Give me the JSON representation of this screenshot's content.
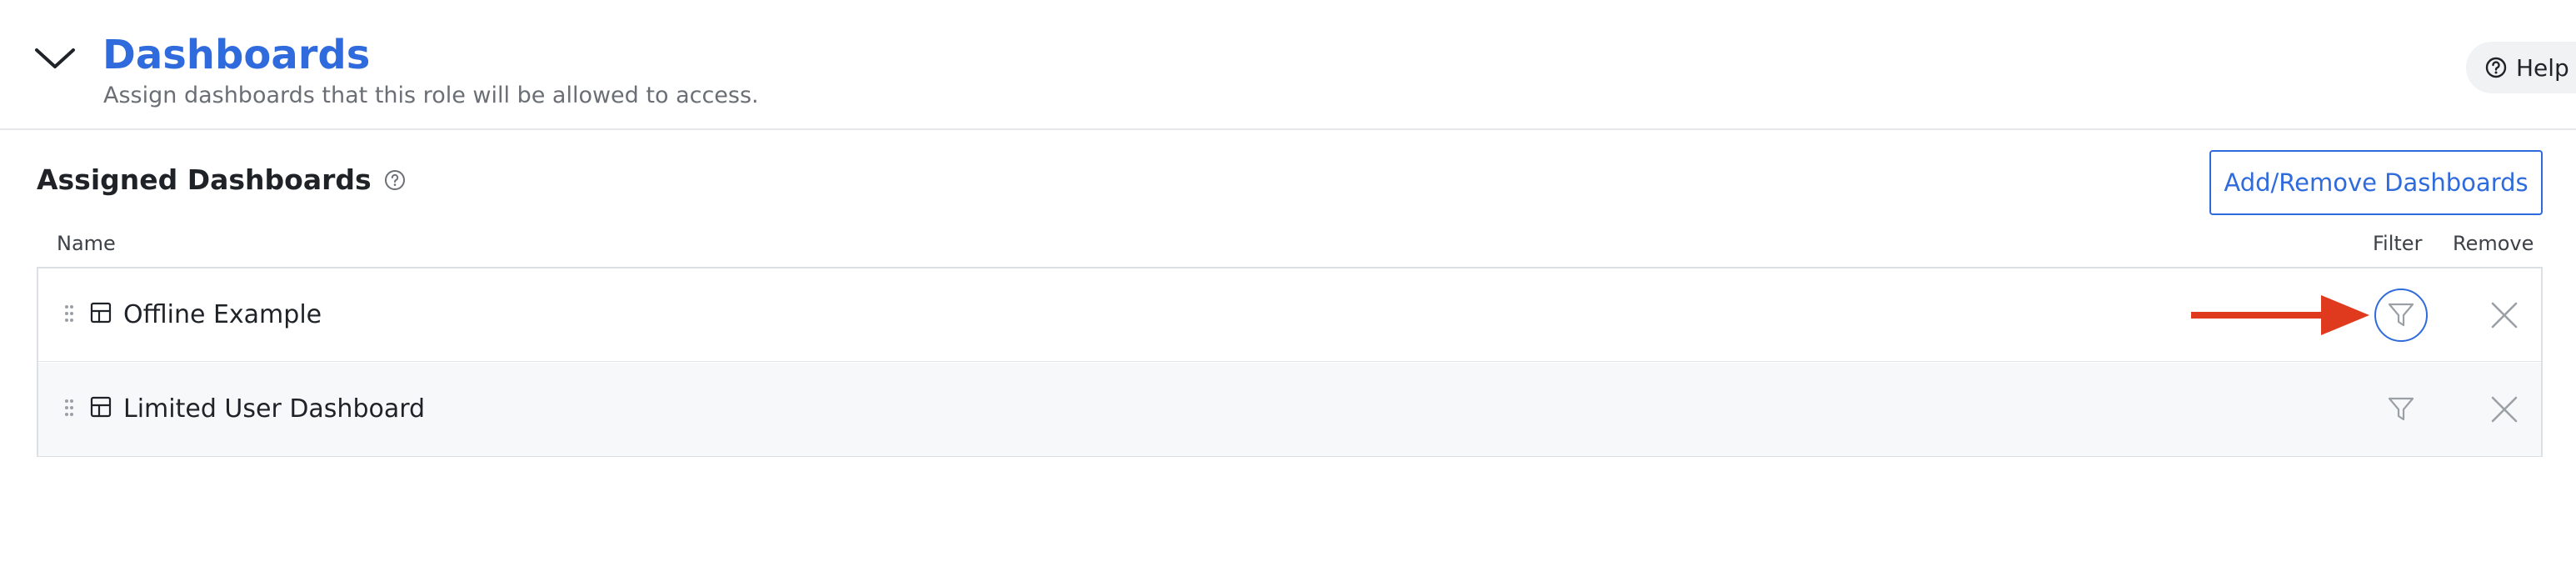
{
  "header": {
    "title": "Dashboards",
    "subtitle": "Assign dashboards that this role will be allowed to access.",
    "help_label": "Help",
    "toggle_icon": "chevron-down-icon"
  },
  "assigned": {
    "title": "Assigned Dashboards",
    "info_icon": "question-circle-icon",
    "add_remove_label": "Add/Remove Dashboards"
  },
  "table": {
    "columns": {
      "name": "Name",
      "filter": "Filter",
      "remove": "Remove"
    },
    "rows": [
      {
        "label": "Offline Example",
        "filter_active": true
      },
      {
        "label": "Limited User Dashboard",
        "filter_active": false
      }
    ]
  },
  "colors": {
    "accent": "#2f6bdc",
    "annotation_arrow": "#e03a1e",
    "muted_icon": "#9aa0a6"
  }
}
